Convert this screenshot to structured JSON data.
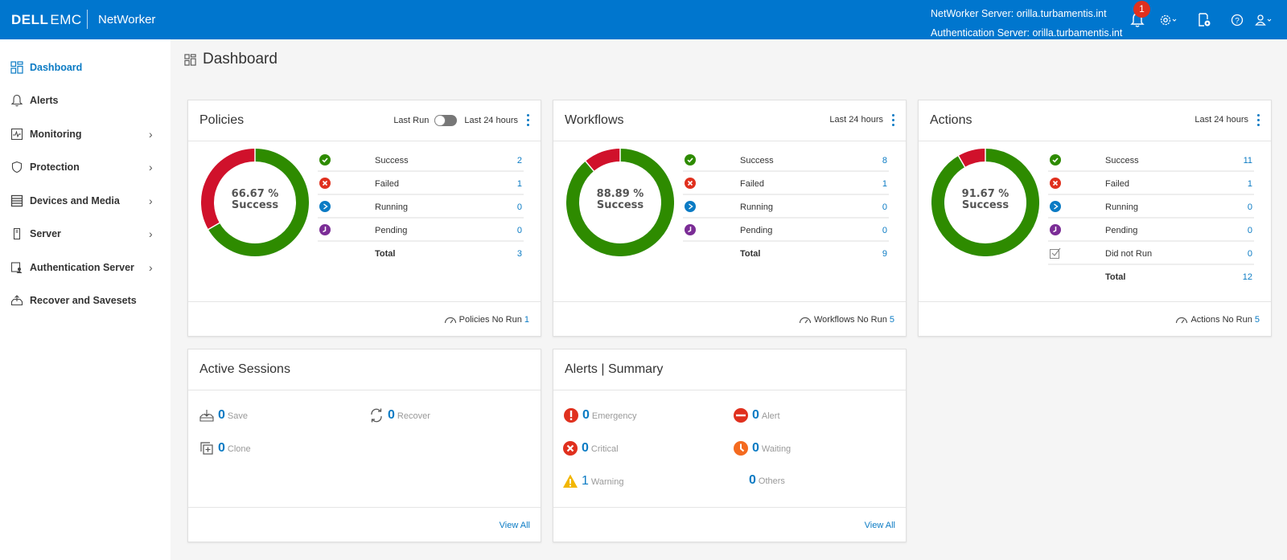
{
  "header": {
    "logo_dell": "DELL",
    "logo_emc": "EMC",
    "app_name": "NetWorker",
    "networker_server": "NetWorker Server: orilla.turbamentis.int",
    "auth_server": "Authentication Server: orilla.turbamentis.int",
    "notification_count": "1",
    "icons": [
      "bell-icon",
      "gear-icon",
      "report-settings-icon",
      "help-icon",
      "user-icon"
    ]
  },
  "sidebar": {
    "items": [
      {
        "label": "Dashboard",
        "icon": "dashboard-icon",
        "active": true,
        "has_children": false
      },
      {
        "label": "Alerts",
        "icon": "bell-icon",
        "active": false,
        "has_children": false
      },
      {
        "label": "Monitoring",
        "icon": "monitoring-icon",
        "active": false,
        "has_children": true
      },
      {
        "label": "Protection",
        "icon": "shield-icon",
        "active": false,
        "has_children": true
      },
      {
        "label": "Devices and Media",
        "icon": "devices-icon",
        "active": false,
        "has_children": true
      },
      {
        "label": "Server",
        "icon": "server-icon",
        "active": false,
        "has_children": true
      },
      {
        "label": "Authentication Server",
        "icon": "auth-server-icon",
        "active": false,
        "has_children": true
      },
      {
        "label": "Recover and Savesets",
        "icon": "recover-icon",
        "active": false,
        "has_children": false
      }
    ]
  },
  "page": {
    "title": "Dashboard"
  },
  "colors": {
    "brand": "#0076ce",
    "link": "#0b7bc4",
    "success": "#2e8b00",
    "failed": "#d0112b",
    "running": "#0b7bc4",
    "pending": "#7b2d96"
  },
  "policies": {
    "title": "Policies",
    "toggle_label": "Last Run",
    "range_label": "Last 24 hours",
    "center_pct": "66.67 %",
    "center_label": "Success",
    "rows": [
      {
        "label": "Success",
        "value": "2",
        "icon": "success-icon"
      },
      {
        "label": "Failed",
        "value": "1",
        "icon": "failed-icon"
      },
      {
        "label": "Running",
        "value": "0",
        "icon": "running-icon"
      },
      {
        "label": "Pending",
        "value": "0",
        "icon": "pending-icon"
      },
      {
        "label": "Total",
        "value": "3",
        "icon": ""
      }
    ],
    "norun_label": "Policies No Run",
    "norun_value": "1"
  },
  "workflows": {
    "title": "Workflows",
    "range_label": "Last 24 hours",
    "center_pct": "88.89 %",
    "center_label": "Success",
    "rows": [
      {
        "label": "Success",
        "value": "8",
        "icon": "success-icon"
      },
      {
        "label": "Failed",
        "value": "1",
        "icon": "failed-icon"
      },
      {
        "label": "Running",
        "value": "0",
        "icon": "running-icon"
      },
      {
        "label": "Pending",
        "value": "0",
        "icon": "pending-icon"
      },
      {
        "label": "Total",
        "value": "9",
        "icon": ""
      }
    ],
    "norun_label": "Workflows No Run",
    "norun_value": "5"
  },
  "actions": {
    "title": "Actions",
    "range_label": "Last 24 hours",
    "center_pct": "91.67 %",
    "center_label": "Success",
    "rows": [
      {
        "label": "Success",
        "value": "11",
        "icon": "success-icon"
      },
      {
        "label": "Failed",
        "value": "1",
        "icon": "failed-icon"
      },
      {
        "label": "Running",
        "value": "0",
        "icon": "running-icon"
      },
      {
        "label": "Pending",
        "value": "0",
        "icon": "pending-icon"
      },
      {
        "label": "Did not Run",
        "value": "0",
        "icon": "did-not-run-icon"
      },
      {
        "label": "Total",
        "value": "12",
        "icon": ""
      }
    ],
    "norun_label": "Actions No Run",
    "norun_value": "5"
  },
  "sessions": {
    "title": "Active Sessions",
    "items": [
      {
        "label": "Save",
        "value": "0",
        "icon": "save-icon"
      },
      {
        "label": "Recover",
        "value": "0",
        "icon": "recover-sync-icon"
      },
      {
        "label": "Clone",
        "value": "0",
        "icon": "clone-icon"
      }
    ],
    "view_all": "View All"
  },
  "alerts_summary": {
    "title": "Alerts | Summary",
    "items": [
      {
        "label": "Emergency",
        "value": "0",
        "icon": "emergency-icon"
      },
      {
        "label": "Alert",
        "value": "0",
        "icon": "alert-minus-icon"
      },
      {
        "label": "Critical",
        "value": "0",
        "icon": "critical-icon"
      },
      {
        "label": "Waiting",
        "value": "0",
        "icon": "waiting-clock-icon"
      },
      {
        "label": "Warning",
        "value": "1",
        "icon": "warning-icon"
      },
      {
        "label": "Others",
        "value": "0",
        "icon": ""
      }
    ],
    "view_all": "View All"
  },
  "chart_data": [
    {
      "type": "pie",
      "title": "Policies",
      "categories": [
        "Success",
        "Failed"
      ],
      "values": [
        2,
        1
      ],
      "donut": true,
      "center_text": "66.67 % Success"
    },
    {
      "type": "pie",
      "title": "Workflows",
      "categories": [
        "Success",
        "Failed"
      ],
      "values": [
        8,
        1
      ],
      "donut": true,
      "center_text": "88.89 % Success"
    },
    {
      "type": "pie",
      "title": "Actions",
      "categories": [
        "Success",
        "Failed"
      ],
      "values": [
        11,
        1
      ],
      "donut": true,
      "center_text": "91.67 % Success"
    }
  ]
}
